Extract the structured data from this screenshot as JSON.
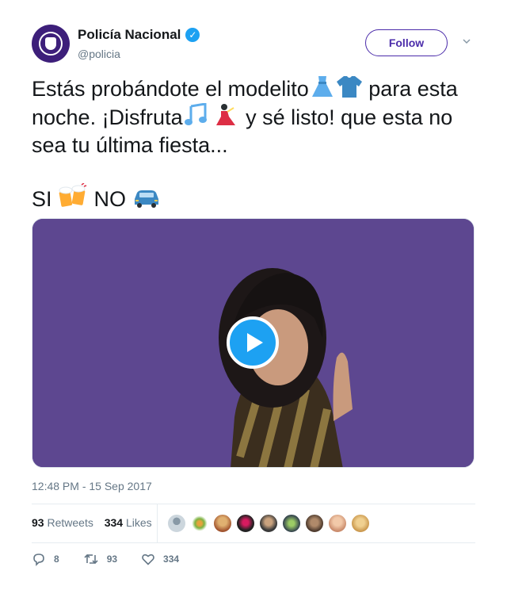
{
  "account": {
    "display_name": "Policía Nacional",
    "handle": "@policia",
    "verified_icon": "verified-badge-icon"
  },
  "follow_button": "Follow",
  "tweet": {
    "line1a": "Estás probándote el modelito",
    "line1b": " para esta",
    "line2a": "noche. ¡Disfruta",
    "line2b": " y sé listo! que esta no",
    "line3": "sea tu última fiesta...",
    "line4a": "SI ",
    "line4b": " NO ",
    "emojis": [
      "dress-icon",
      "tshirt-icon",
      "music-notes-icon",
      "dancer-icon",
      "beer-mugs-icon",
      "car-icon"
    ]
  },
  "media": {
    "type": "video",
    "play_icon": "play-icon"
  },
  "timestamp": "12:48 PM - 15 Sep 2017",
  "stats": {
    "retweets_count": "93",
    "retweets_label": "Retweets",
    "likes_count": "334",
    "likes_label": "Likes"
  },
  "actions": {
    "replies": "8",
    "retweets": "93",
    "likes": "334"
  },
  "colors": {
    "accent": "#1da1f2",
    "follow": "#4b2caa",
    "video_bg": "#5d4790"
  }
}
